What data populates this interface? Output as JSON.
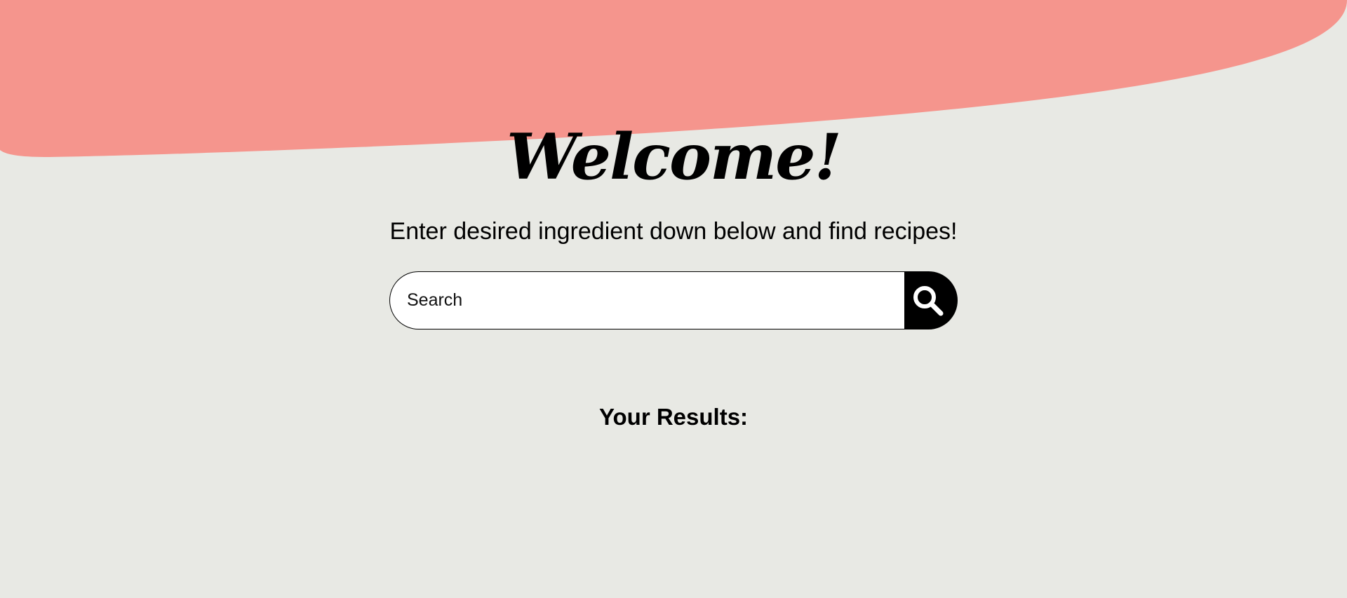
{
  "colors": {
    "background": "#e8e9e4",
    "blob": "#f5958d",
    "text": "#000000",
    "search_button": "#000000"
  },
  "hero": {
    "title": "Welcome!",
    "subtitle": "Enter desired ingredient down below and find recipes!"
  },
  "search": {
    "placeholder": "Search",
    "value": "",
    "button_icon": "search-icon"
  },
  "results": {
    "heading": "Your Results:",
    "items": []
  }
}
